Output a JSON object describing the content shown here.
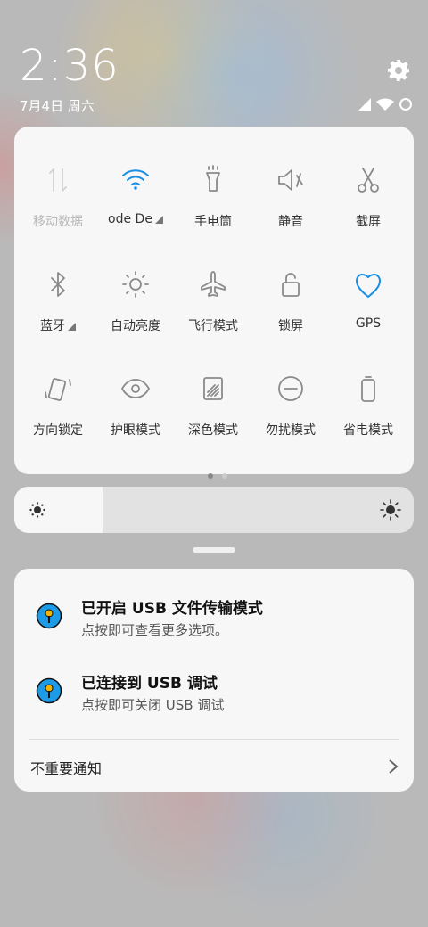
{
  "status": {
    "time": "2:36",
    "date": "7月4日 周六"
  },
  "tiles": [
    {
      "label": "移动数据",
      "icon": "mobile-data-icon",
      "dim": true
    },
    {
      "label": "ode   De",
      "icon": "wifi-icon",
      "caret": true
    },
    {
      "label": "手电筒",
      "icon": "flashlight-icon"
    },
    {
      "label": "静音",
      "icon": "mute-icon"
    },
    {
      "label": "截屏",
      "icon": "scissors-icon"
    },
    {
      "label": "蓝牙",
      "icon": "bluetooth-icon",
      "caret": true
    },
    {
      "label": "自动亮度",
      "icon": "auto-brightness-icon"
    },
    {
      "label": "飞行模式",
      "icon": "airplane-icon"
    },
    {
      "label": "锁屏",
      "icon": "lock-icon"
    },
    {
      "label": "GPS",
      "icon": "gps-icon"
    },
    {
      "label": "方向锁定",
      "icon": "rotation-lock-icon"
    },
    {
      "label": "护眼模式",
      "icon": "eye-icon"
    },
    {
      "label": "深色模式",
      "icon": "dark-mode-icon"
    },
    {
      "label": "勿扰模式",
      "icon": "dnd-icon"
    },
    {
      "label": "省电模式",
      "icon": "battery-saver-icon"
    }
  ],
  "pager": {
    "pages": 2,
    "current": 1
  },
  "brightness": {
    "level": 0.22
  },
  "notifications": [
    {
      "title": "已开启 USB 文件传输模式",
      "subtitle": "点按即可查看更多选项。",
      "icon": "usb-notification-icon"
    },
    {
      "title": "已连接到 USB 调试",
      "subtitle": "点按即可关闭 USB 调试",
      "icon": "usb-notification-icon"
    }
  ],
  "unimportant": {
    "label": "不重要通知"
  },
  "colors": {
    "accent": "#1a8fe3",
    "usb_icon_fill": "#1e9be6",
    "usb_icon_mark": "#f2b400"
  }
}
